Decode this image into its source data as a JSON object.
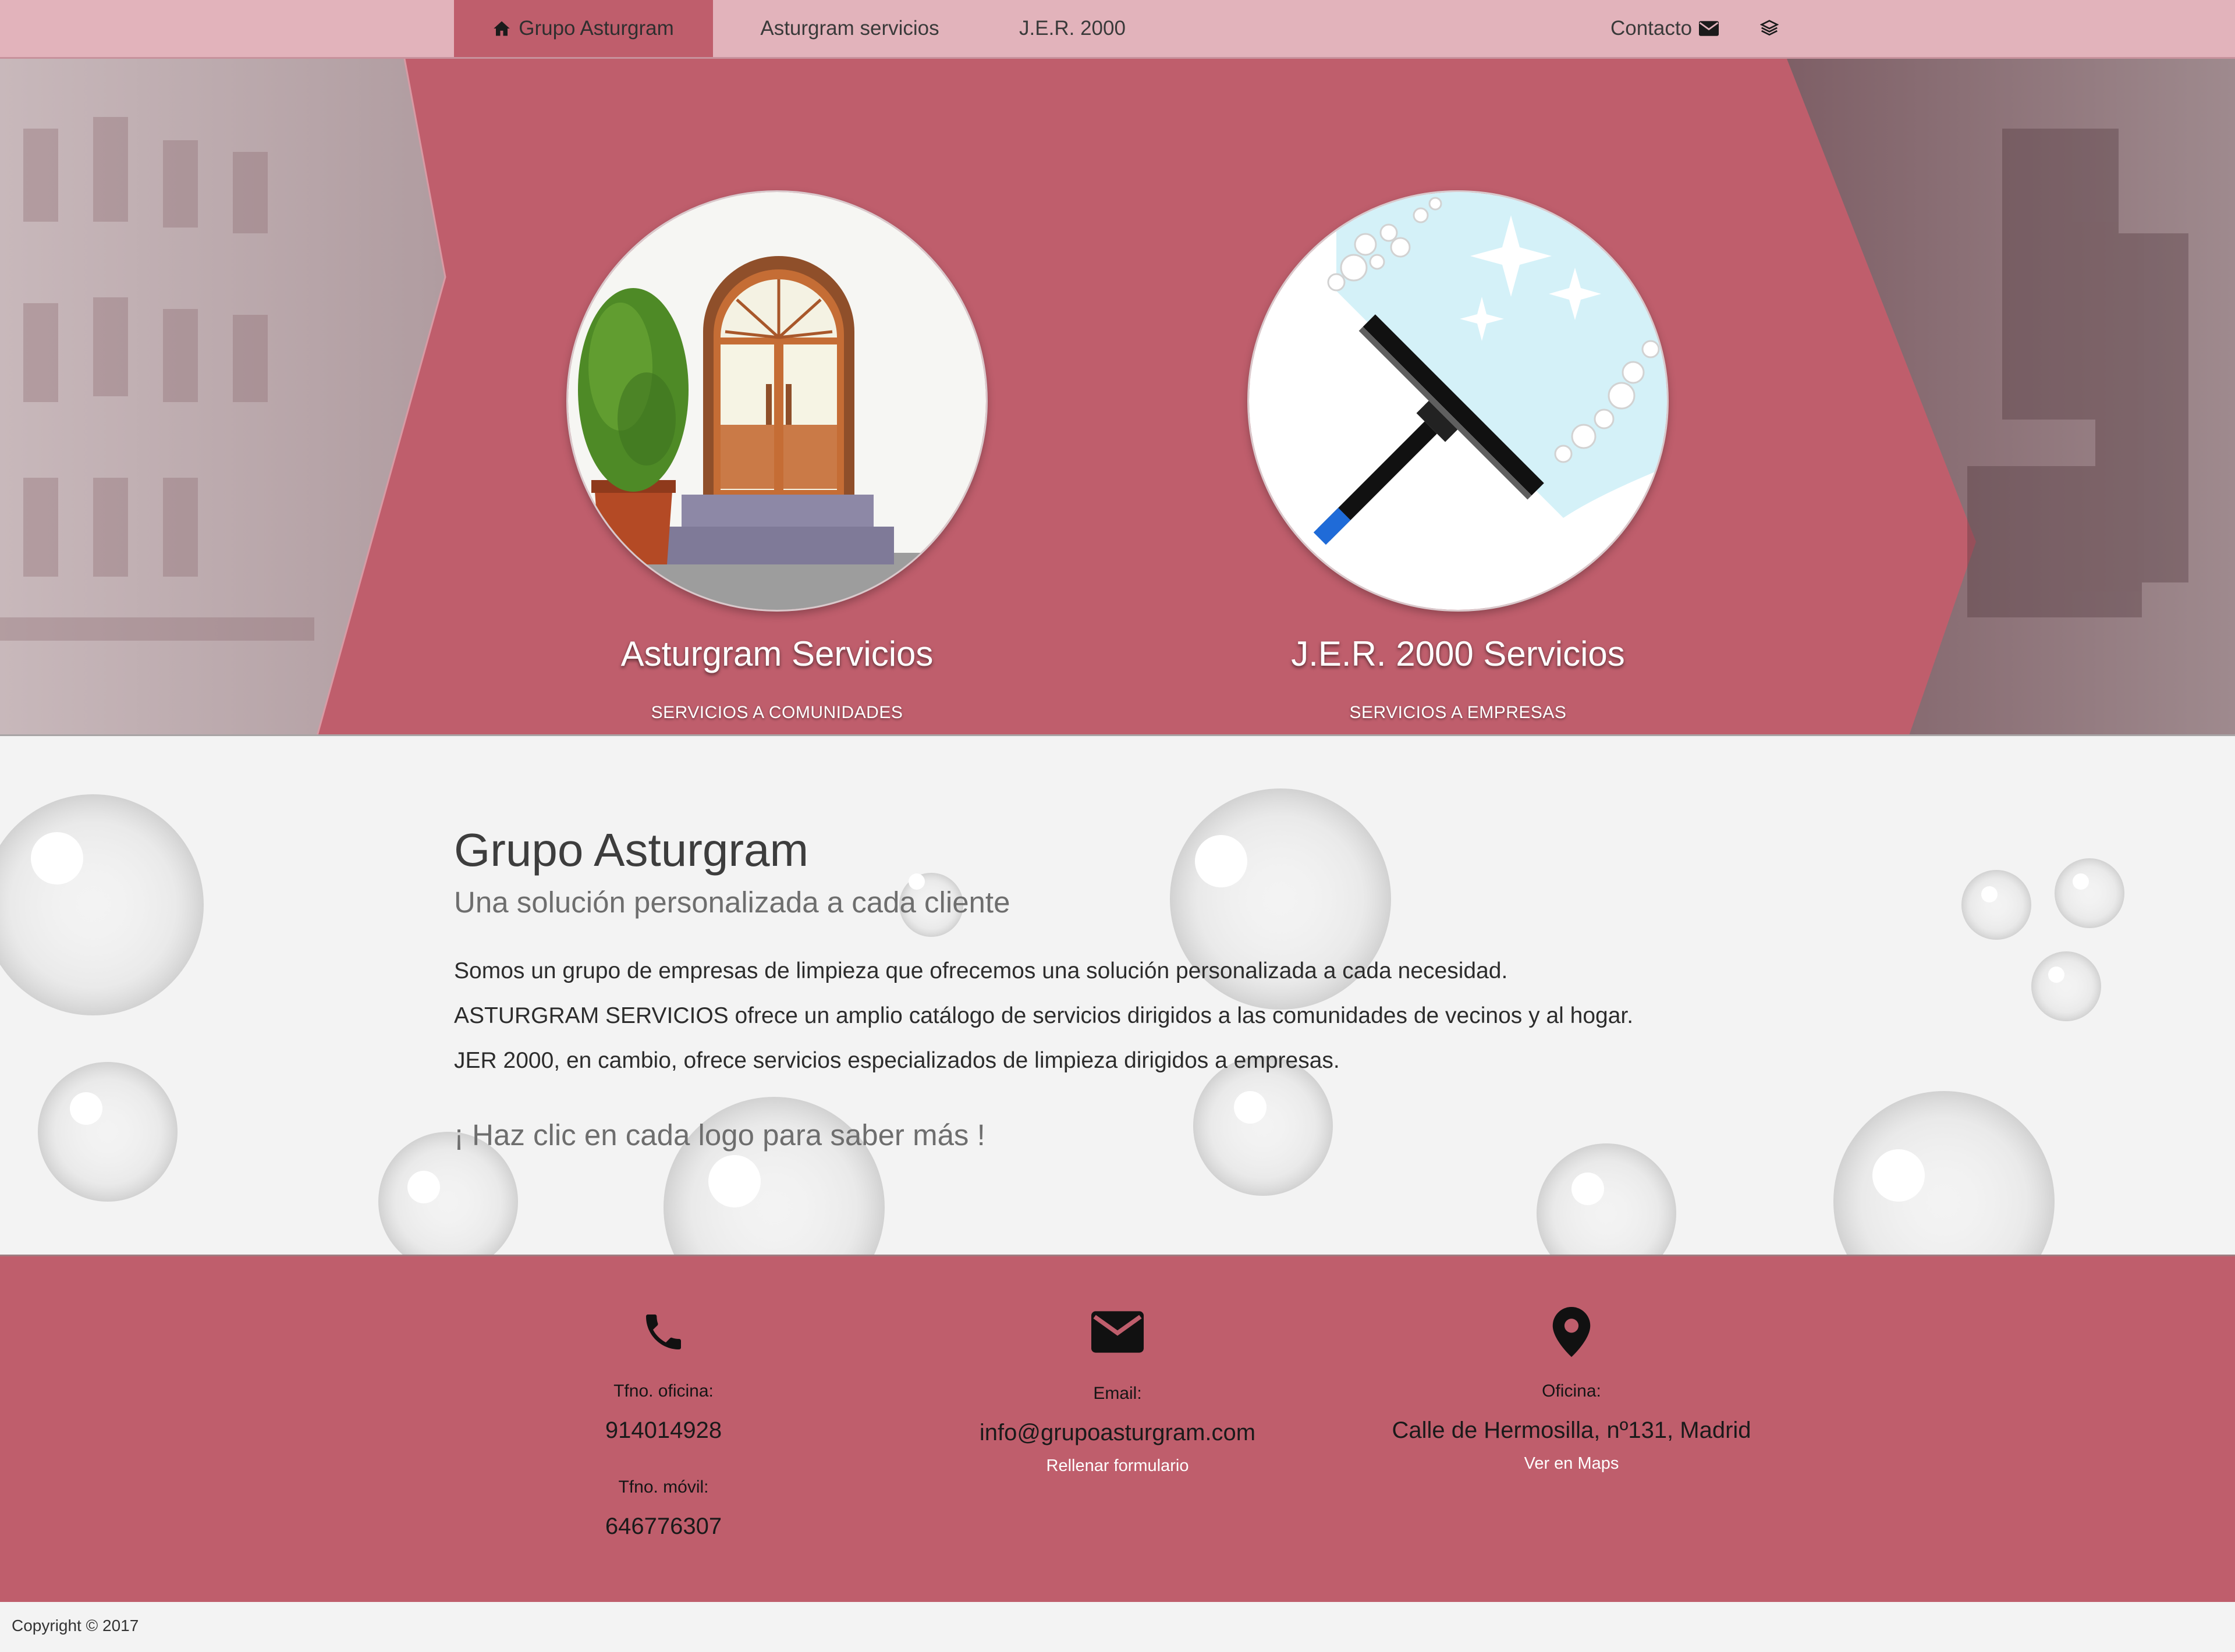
{
  "nav": {
    "items": [
      {
        "label": "Grupo Asturgram",
        "active": true,
        "icon": "home-icon"
      },
      {
        "label": "Asturgram servicios"
      },
      {
        "label": "J.E.R. 2000"
      }
    ],
    "contact_label": "Contacto",
    "contact_icon": "mail-icon",
    "layers_icon": "layers-icon"
  },
  "hero": {
    "services": [
      {
        "title": "Asturgram Servicios",
        "subtitle": "SERVICIOS A COMUNIDADES",
        "image": "building-entrance-illustration"
      },
      {
        "title": "J.E.R. 2000 Servicios",
        "subtitle": "SERVICIOS A EMPRESAS",
        "image": "window-squeegee-illustration"
      }
    ]
  },
  "intro": {
    "heading": "Grupo Asturgram",
    "subheading": "Una solución personalizada a cada cliente",
    "paragraphs": [
      "Somos un grupo de empresas de limpieza que ofrecemos una solución personalizada a cada necesidad.",
      "ASTURGRAM SERVICIOS ofrece un amplio catálogo de servicios dirigidos a las comunidades de vecinos y al hogar.",
      "JER 2000, en cambio, ofrece servicios especializados de limpieza dirigidos a empresas."
    ],
    "cta": "¡ Haz clic en cada logo para saber más !"
  },
  "footer": {
    "phone": {
      "icon": "phone-icon",
      "office_label": "Tfno. oficina:",
      "office_number": "914014928",
      "mobile_label": "Tfno. móvil:",
      "mobile_number": "646776307"
    },
    "email": {
      "icon": "email-icon",
      "label": "Email:",
      "address": "info@grupoasturgram.com",
      "form_link": "Rellenar formulario"
    },
    "office": {
      "icon": "map-pin-icon",
      "label": "Oficina:",
      "address": "Calle de Hermosilla, nº131, Madrid",
      "maps_link": "Ver en Maps"
    }
  },
  "copyright": "Copyright © 2017",
  "colors": {
    "brand": "#bf5e6c",
    "nav_bg": "#e2b3bb",
    "page_bg": "#f3f3f3"
  }
}
